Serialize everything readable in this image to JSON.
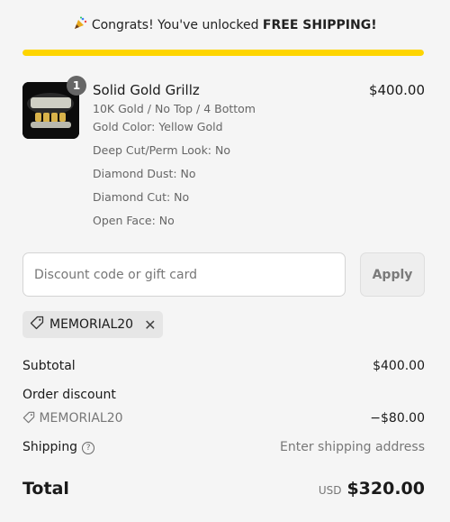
{
  "banner": {
    "text": "Congrats! You've unlocked",
    "bold": "FREE SHIPPING!",
    "icon": "party-popper-icon"
  },
  "progress": {
    "fraction": 1.0,
    "color": "#fed500"
  },
  "product": {
    "quantity": "1",
    "title": "Solid Gold Grillz",
    "variant": "10K Gold / No Top / 4 Bottom",
    "options": [
      "Gold Color: Yellow Gold",
      "Deep Cut/Perm Look: No",
      "Diamond Dust: No",
      "Diamond Cut: No",
      "Open Face: No"
    ],
    "price": "$400.00"
  },
  "discount": {
    "placeholder": "Discount code or gift card",
    "apply_label": "Apply",
    "applied_code": "MEMORIAL20"
  },
  "summary": {
    "subtotal_label": "Subtotal",
    "subtotal_value": "$400.00",
    "order_discount_label": "Order discount",
    "discount_code": "MEMORIAL20",
    "discount_value": "−$80.00",
    "shipping_label": "Shipping",
    "shipping_value": "Enter shipping address",
    "total_label": "Total",
    "currency": "USD",
    "total_value": "$320.00"
  }
}
